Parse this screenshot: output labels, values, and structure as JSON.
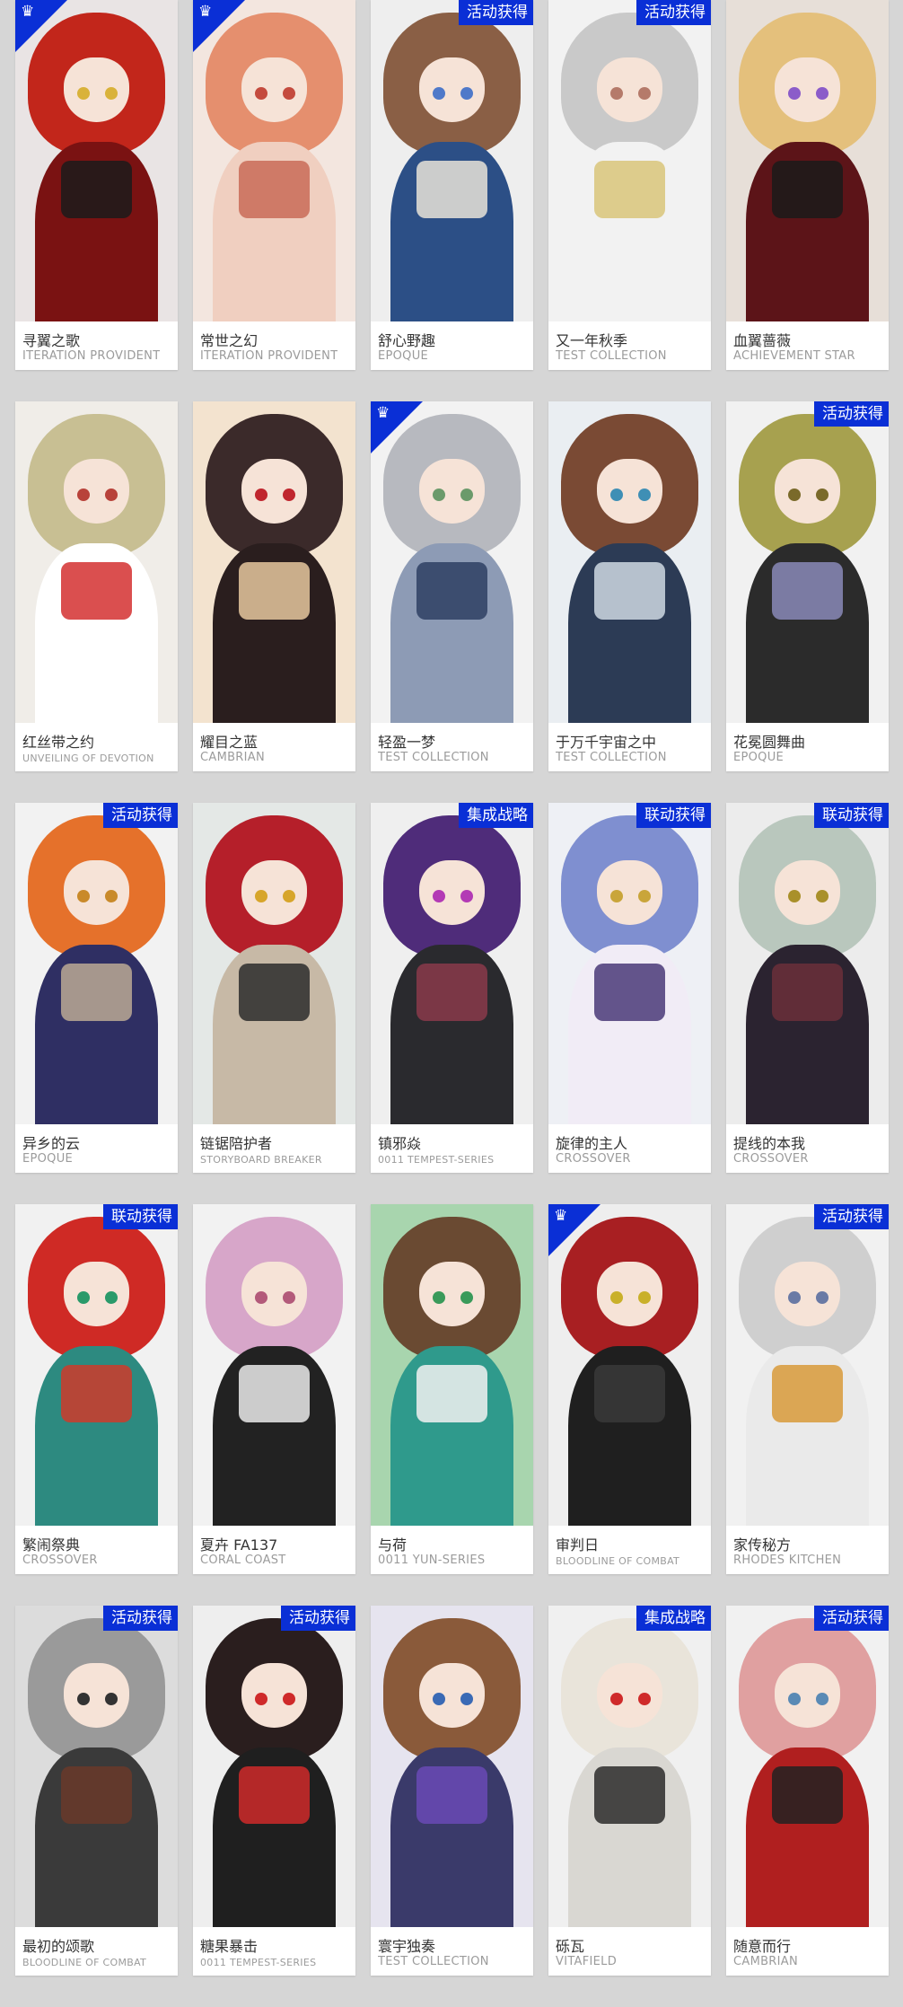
{
  "cards": [
    {
      "name": "寻翼之歌",
      "series": "ITERATION PROVIDENT",
      "badge": "",
      "corner": true,
      "colors": {
        "bg": "#e9e4e4",
        "hair": "#c2261b",
        "body": "#7a1212",
        "accent": "#1b1b1b",
        "eye": "#d9b23a"
      }
    },
    {
      "name": "常世之幻",
      "series": "ITERATION PROVIDENT",
      "badge": "",
      "corner": true,
      "colors": {
        "bg": "#f3e6df",
        "hair": "#e58f6e",
        "body": "#f0cfc0",
        "accent": "#c96b57",
        "eye": "#c44b3e"
      }
    },
    {
      "name": "舒心野趣",
      "series": "EPOQUE",
      "badge": "活动获得",
      "corner": false,
      "colors": {
        "bg": "#eeeeee",
        "hair": "#8a5f45",
        "body": "#2c4f86",
        "accent": "#e9e3d8",
        "eye": "#4f79c9"
      }
    },
    {
      "name": "又一年秋季",
      "series": "TEST COLLECTION",
      "badge": "活动获得",
      "corner": false,
      "colors": {
        "bg": "#f2f2f2",
        "hair": "#c9c9c9",
        "body": "#f2f2f2",
        "accent": "#d9c57a",
        "eye": "#b57a6a"
      }
    },
    {
      "name": "血翼蔷薇",
      "series": "ACHIEVEMENT STAR",
      "badge": "",
      "corner": false,
      "colors": {
        "bg": "#e7dfd8",
        "hair": "#e4c07c",
        "body": "#5c1418",
        "accent": "#1a1a1a",
        "eye": "#8b5cc9"
      }
    },
    {
      "name": "红丝带之约",
      "series": "UNVEILING OF DEVOTION",
      "badge": "",
      "corner": false,
      "colors": {
        "bg": "#f0ede8",
        "hair": "#c8bf93",
        "body": "#ffffff",
        "accent": "#d43030",
        "eye": "#b8423a"
      }
    },
    {
      "name": "耀目之蓝",
      "series": "CAMBRIAN",
      "badge": "",
      "corner": false,
      "colors": {
        "bg": "#f3e3cf",
        "hair": "#3b2a2a",
        "body": "#2a1e1e",
        "accent": "#e6c89f",
        "eye": "#c0262e"
      }
    },
    {
      "name": "轻盈一梦",
      "series": "TEST COLLECTION",
      "badge": "",
      "corner": true,
      "colors": {
        "bg": "#f2f2f2",
        "hair": "#b7b9bf",
        "body": "#8d9bb5",
        "accent": "#2e3f63",
        "eye": "#6b9a6b"
      }
    },
    {
      "name": "于万千宇宙之中",
      "series": "TEST COLLECTION",
      "badge": "",
      "corner": false,
      "colors": {
        "bg": "#eaeef2",
        "hair": "#7a4a34",
        "body": "#2c3b55",
        "accent": "#cfd9e3",
        "eye": "#3f8fb5"
      }
    },
    {
      "name": "花冕圆舞曲",
      "series": "EPOQUE",
      "badge": "活动获得",
      "corner": false,
      "colors": {
        "bg": "#f1f1f1",
        "hair": "#a7a14f",
        "body": "#2b2b2b",
        "accent": "#8a8ab8",
        "eye": "#7a6a2a"
      }
    },
    {
      "name": "异乡的云",
      "series": "EPOQUE",
      "badge": "活动获得",
      "corner": false,
      "colors": {
        "bg": "#f2f2f2",
        "hair": "#e5712b",
        "body": "#2f2f63",
        "accent": "#bba994",
        "eye": "#c98a2a"
      }
    },
    {
      "name": "链锯陪护者",
      "series": "STORYBOARD BREAKER",
      "badge": "",
      "corner": false,
      "colors": {
        "bg": "#e4e8e6",
        "hair": "#b51f2a",
        "body": "#c7b9a6",
        "accent": "#2b2b2b",
        "eye": "#d7a52a"
      }
    },
    {
      "name": "镇邪焱",
      "series": "0011 TEMPEST-SERIES",
      "badge": "集成战略",
      "corner": false,
      "colors": {
        "bg": "#efefef",
        "hair": "#4f2c7a",
        "body": "#2a2a2e",
        "accent": "#8a3a4a",
        "eye": "#b33ab5"
      }
    },
    {
      "name": "旋律的主人",
      "series": "CROSSOVER",
      "badge": "联动获得",
      "corner": false,
      "colors": {
        "bg": "#eef0f5",
        "hair": "#7f8fd0",
        "body": "#f1ecf6",
        "accent": "#4a3a78",
        "eye": "#c9a53a"
      }
    },
    {
      "name": "提线的本我",
      "series": "CROSSOVER",
      "badge": "联动获得",
      "corner": false,
      "colors": {
        "bg": "#ececec",
        "hair": "#b9c7bd",
        "body": "#2b2330",
        "accent": "#6b2f3a",
        "eye": "#a9902a"
      }
    },
    {
      "name": "繁闹祭典",
      "series": "CROSSOVER",
      "badge": "联动获得",
      "corner": false,
      "colors": {
        "bg": "#f1f1f1",
        "hair": "#cf2a25",
        "body": "#2d8a80",
        "accent": "#cf3a2a",
        "eye": "#2a9a6a"
      }
    },
    {
      "name": "夏卉 FA137",
      "series": "CORAL COAST",
      "badge": "",
      "corner": false,
      "colors": {
        "bg": "#f2f2f2",
        "hair": "#d7a6c9",
        "body": "#222222",
        "accent": "#eaeaea",
        "eye": "#b35a7a"
      }
    },
    {
      "name": "与荷",
      "series": "0011 YUN-SERIES",
      "badge": "",
      "corner": false,
      "colors": {
        "bg": "#a8d5ae",
        "hair": "#6a4a32",
        "body": "#2f9a8c",
        "accent": "#f1f1f1",
        "eye": "#3a9a5a"
      }
    },
    {
      "name": "审判日",
      "series": "BLOODLINE OF COMBAT",
      "badge": "",
      "corner": true,
      "colors": {
        "bg": "#eeeeee",
        "hair": "#a81f22",
        "body": "#1f1f1f",
        "accent": "#3a3a3a",
        "eye": "#c9b02a"
      }
    },
    {
      "name": "家传秘方",
      "series": "RHODES KITCHEN",
      "badge": "活动获得",
      "corner": false,
      "colors": {
        "bg": "#f1f1f1",
        "hair": "#cfcfcf",
        "body": "#eaeaea",
        "accent": "#d89a3a",
        "eye": "#6a7aa5"
      }
    },
    {
      "name": "最初的颂歌",
      "series": "BLOODLINE OF COMBAT",
      "badge": "活动获得",
      "corner": false,
      "colors": {
        "bg": "#dcdcdc",
        "hair": "#9a9a9a",
        "body": "#3a3a3a",
        "accent": "#6a3a2a",
        "eye": "#333333"
      }
    },
    {
      "name": "糖果暴击",
      "series": "0011 TEMPEST-SERIES",
      "badge": "活动获得",
      "corner": false,
      "colors": {
        "bg": "#eeeeee",
        "hair": "#2a1e1e",
        "body": "#1f1f1f",
        "accent": "#cf2a2a",
        "eye": "#cf2a2a"
      }
    },
    {
      "name": "寰宇独奏",
      "series": "TEST COLLECTION",
      "badge": "",
      "corner": false,
      "colors": {
        "bg": "#e6e4ef",
        "hair": "#8a5a3a",
        "body": "#3a3a6a",
        "accent": "#6a4ab5",
        "eye": "#3a6ab5"
      }
    },
    {
      "name": "砾瓦",
      "series": "VITAFIELD",
      "badge": "集成战略",
      "corner": false,
      "colors": {
        "bg": "#f0f0f0",
        "hair": "#e9e4da",
        "body": "#d9d7d2",
        "accent": "#2b2b2b",
        "eye": "#cf2a2a"
      }
    },
    {
      "name": "随意而行",
      "series": "CAMBRIAN",
      "badge": "活动获得",
      "corner": false,
      "colors": {
        "bg": "#f1f1f1",
        "hair": "#e0a0a0",
        "body": "#b01f1f",
        "accent": "#222222",
        "eye": "#5a8ab5"
      }
    }
  ],
  "icons": {
    "corner": "skin-crest-icon"
  }
}
